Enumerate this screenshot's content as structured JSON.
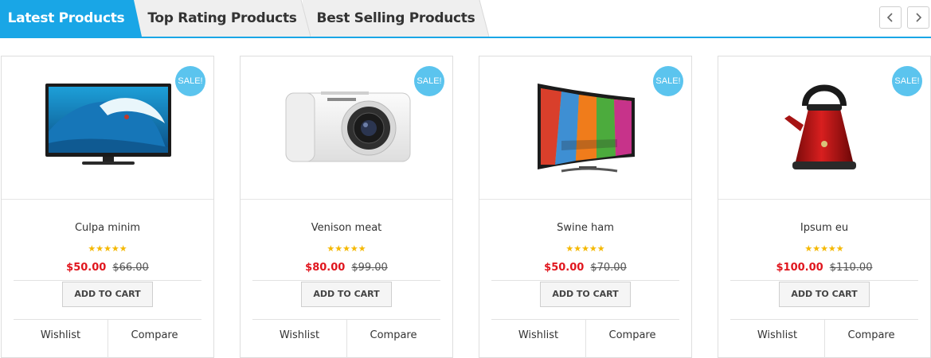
{
  "tabs": [
    {
      "label": "Latest Products",
      "active": true
    },
    {
      "label": "Top Rating Products",
      "active": false
    },
    {
      "label": "Best Selling Products",
      "active": false
    }
  ],
  "nav": {
    "prev_icon": "chevron-left-icon",
    "next_icon": "chevron-right-icon"
  },
  "colors": {
    "accent": "#19a6e6",
    "sale_badge": "#5bc4ee",
    "price_new": "#e0161e",
    "stars": "#f5b800"
  },
  "products": [
    {
      "name": "Culpa minim",
      "badge": "SALE!",
      "rating": 5,
      "stars": "★★★★★",
      "price_new": "$50.00",
      "price_old": "$66.00",
      "cart_label": "ADD TO CART",
      "wishlist_label": "Wishlist",
      "compare_label": "Compare",
      "image": "tv-flat"
    },
    {
      "name": "Venison meat",
      "badge": "SALE!",
      "rating": 5,
      "stars": "★★★★★",
      "price_new": "$80.00",
      "price_old": "$99.00",
      "cart_label": "ADD TO CART",
      "wishlist_label": "Wishlist",
      "compare_label": "Compare",
      "image": "camera"
    },
    {
      "name": "Swine ham",
      "badge": "SALE!",
      "rating": 5,
      "stars": "★★★★★",
      "price_new": "$50.00",
      "price_old": "$70.00",
      "cart_label": "ADD TO CART",
      "wishlist_label": "Wishlist",
      "compare_label": "Compare",
      "image": "tv-curved"
    },
    {
      "name": "Ipsum eu",
      "badge": "SALE!",
      "rating": 5,
      "stars": "★★★★★",
      "price_new": "$100.00",
      "price_old": "$110.00",
      "cart_label": "ADD TO CART",
      "wishlist_label": "Wishlist",
      "compare_label": "Compare",
      "image": "kettle"
    }
  ]
}
